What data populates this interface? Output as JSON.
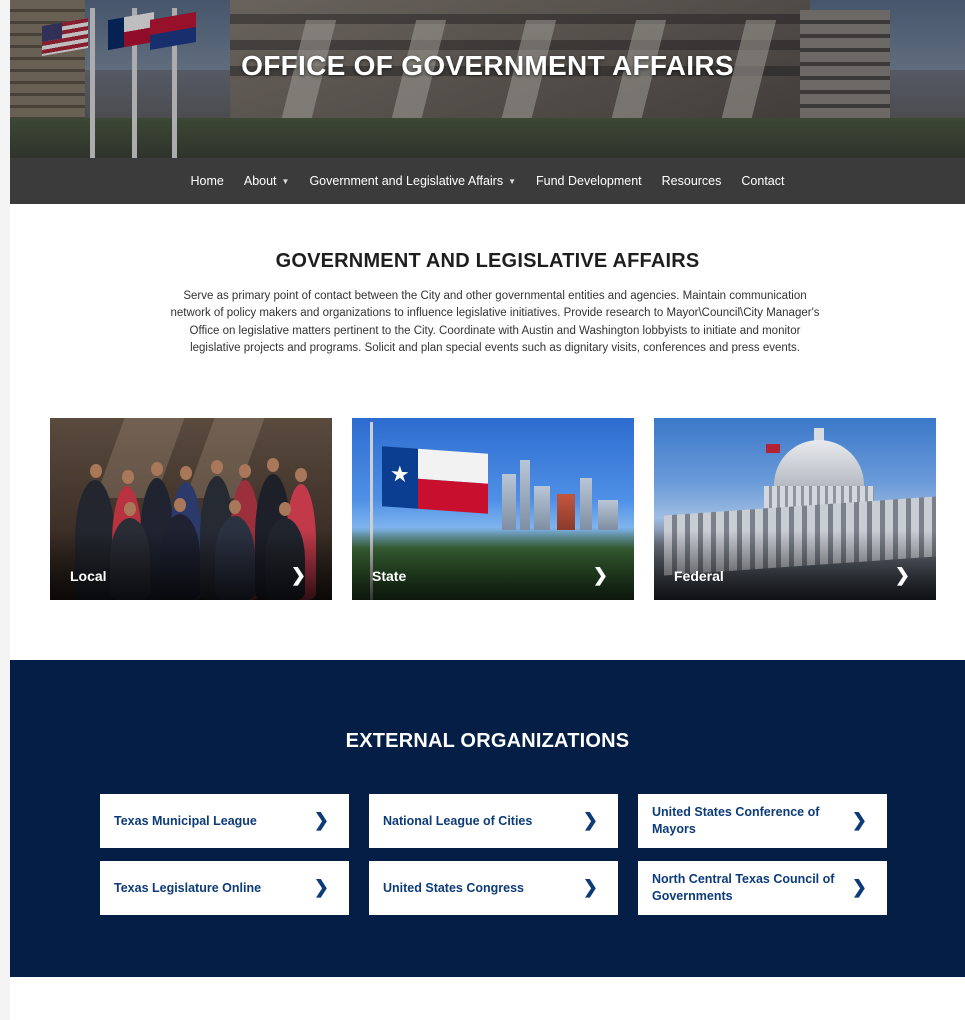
{
  "hero": {
    "title": "OFFICE OF GOVERNMENT AFFAIRS"
  },
  "nav": {
    "items": [
      {
        "label": "Home",
        "has_dropdown": false
      },
      {
        "label": "About",
        "has_dropdown": true
      },
      {
        "label": "Government and Legislative Affairs",
        "has_dropdown": true
      },
      {
        "label": "Fund Development",
        "has_dropdown": false
      },
      {
        "label": "Resources",
        "has_dropdown": false
      },
      {
        "label": "Contact",
        "has_dropdown": false
      }
    ],
    "caret_icon": "caret-down-icon"
  },
  "main": {
    "title": "GOVERNMENT AND LEGISLATIVE AFFAIRS",
    "description": "Serve as primary point of contact between the City and other governmental entities and agencies. Maintain communication network of policy makers and organizations to influence legislative initiatives. Provide research to Mayor\\Council\\City Manager's Office on legislative matters pertinent to the City. Coordinate with Austin and Washington lobbyists to initiate and monitor legislative projects and programs. Solicit and plan special events such as dignitary visits, conferences and press events."
  },
  "cards": [
    {
      "label": "Local",
      "icon": "chevron-right-icon"
    },
    {
      "label": "State",
      "icon": "chevron-right-icon"
    },
    {
      "label": "Federal",
      "icon": "chevron-right-icon"
    }
  ],
  "external": {
    "title": "EXTERNAL ORGANIZATIONS",
    "links": [
      {
        "label": "Texas Municipal League"
      },
      {
        "label": "National League of Cities"
      },
      {
        "label": "United States Conference of Mayors"
      },
      {
        "label": "Texas Legislature Online"
      },
      {
        "label": "United States Congress"
      },
      {
        "label": "North Central Texas Council of Governments"
      }
    ]
  },
  "colors": {
    "nav_bg": "#3b3b3b",
    "external_bg": "#041e45",
    "link_text": "#0d3b7a"
  }
}
